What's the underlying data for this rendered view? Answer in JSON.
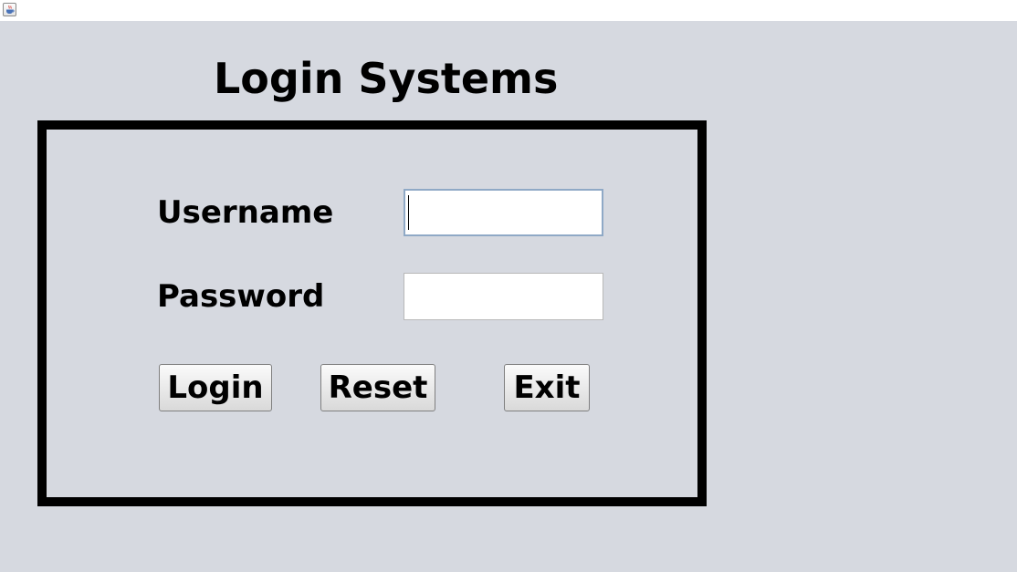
{
  "window": {
    "app_icon": "java-cup-icon"
  },
  "form": {
    "title": "Login Systems",
    "username_label": "Username",
    "password_label": "Password",
    "username_value": "",
    "password_value": ""
  },
  "buttons": {
    "login": "Login",
    "reset": "Reset",
    "exit": "Exit"
  },
  "colors": {
    "background": "#d6d9e0",
    "frame_border": "#000000",
    "focus_border": "#8fa9c6"
  }
}
